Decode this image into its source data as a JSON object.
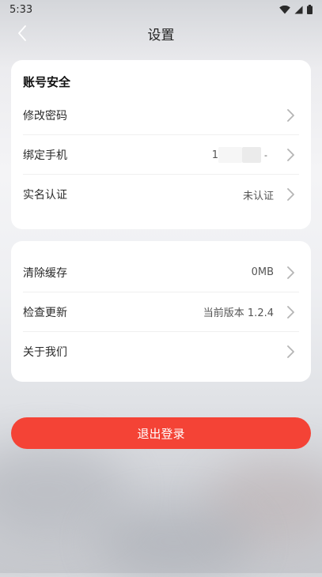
{
  "status_bar": {
    "time": "5:33"
  },
  "header": {
    "title": "设置"
  },
  "account_section": {
    "title": "账号安全",
    "items": [
      {
        "label": "修改密码",
        "value": ""
      },
      {
        "label": "绑定手机",
        "value_prefix": "1",
        "value_suffix": "-"
      },
      {
        "label": "实名认证",
        "value": "未认证"
      }
    ]
  },
  "general_section": {
    "items": [
      {
        "label": "清除缓存",
        "value": "0MB"
      },
      {
        "label": "检查更新",
        "value": "当前版本 1.2.4"
      },
      {
        "label": "关于我们",
        "value": ""
      }
    ]
  },
  "logout": {
    "label": "退出登录"
  },
  "colors": {
    "accent": "#f44336",
    "card": "#ffffff",
    "chevron": "#b5b5b5"
  }
}
